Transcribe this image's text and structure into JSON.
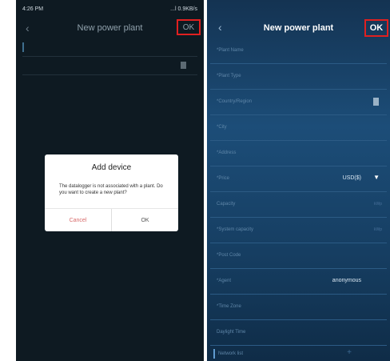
{
  "left": {
    "status_time": "4:26 PM",
    "status_icons": "...l 0.9KB/s",
    "nav_title": "New power plant",
    "ok_label": "OK",
    "dialog": {
      "title": "Add device",
      "message": "The datalogger is not associated with a plant. Do you want to create a new plant?",
      "cancel_label": "Cancel",
      "ok_label": "OK"
    }
  },
  "right": {
    "nav_title": "New power plant",
    "ok_label": "OK",
    "fields": [
      {
        "label": "*Plant Name",
        "value": "",
        "unit": ""
      },
      {
        "label": "*Plant Type",
        "value": "",
        "unit": ""
      },
      {
        "label": "*Country/Region",
        "value": "",
        "unit": ""
      },
      {
        "label": "*City",
        "value": "",
        "unit": ""
      },
      {
        "label": "*Address",
        "value": "",
        "unit": ""
      },
      {
        "label": "*Price",
        "value": "USD($)",
        "unit": ""
      },
      {
        "label": "Capacity",
        "value": "",
        "unit": "kWp"
      },
      {
        "label": "*System capacity",
        "value": "",
        "unit": "kWp"
      },
      {
        "label": "*Post Code",
        "value": "",
        "unit": ""
      },
      {
        "label": "*Agent",
        "value": "anonymous",
        "unit": ""
      },
      {
        "label": "*Time Zone",
        "value": "",
        "unit": ""
      },
      {
        "label": "Daylight Time",
        "value": "",
        "unit": ""
      }
    ],
    "bottom_label": "Network list"
  },
  "colors": {
    "highlight": "#e02020",
    "right_bg": "#1c4d78",
    "left_bg": "#0e1a22"
  }
}
